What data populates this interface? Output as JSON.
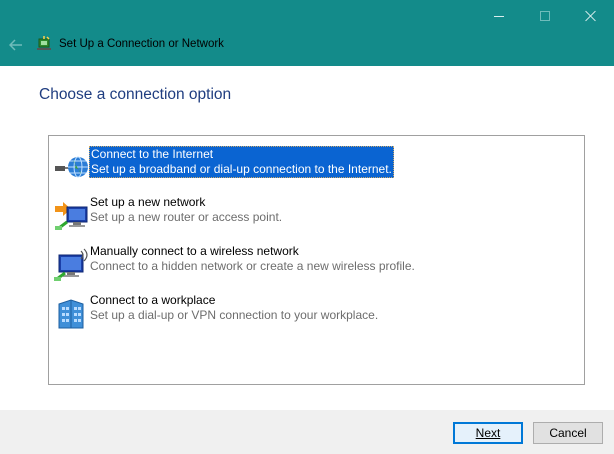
{
  "window": {
    "title": "Set Up a Connection or Network",
    "accent": "#138b8a"
  },
  "heading": "Choose a connection option",
  "options": [
    {
      "title": "Connect to the Internet",
      "description": "Set up a broadband or dial-up connection to the Internet.",
      "icon": "globe-network-icon",
      "selected": true
    },
    {
      "title": "Set up a new network",
      "description": "Set up a new router or access point.",
      "icon": "new-network-icon",
      "selected": false
    },
    {
      "title": "Manually connect to a wireless network",
      "description": "Connect to a hidden network or create a new wireless profile.",
      "icon": "wireless-network-icon",
      "selected": false
    },
    {
      "title": "Connect to a workplace",
      "description": "Set up a dial-up or VPN connection to your workplace.",
      "icon": "workplace-building-icon",
      "selected": false
    }
  ],
  "buttons": {
    "next": "Next",
    "cancel": "Cancel"
  },
  "colors": {
    "heading": "#1f3d80",
    "selection": "#0a64d2"
  }
}
